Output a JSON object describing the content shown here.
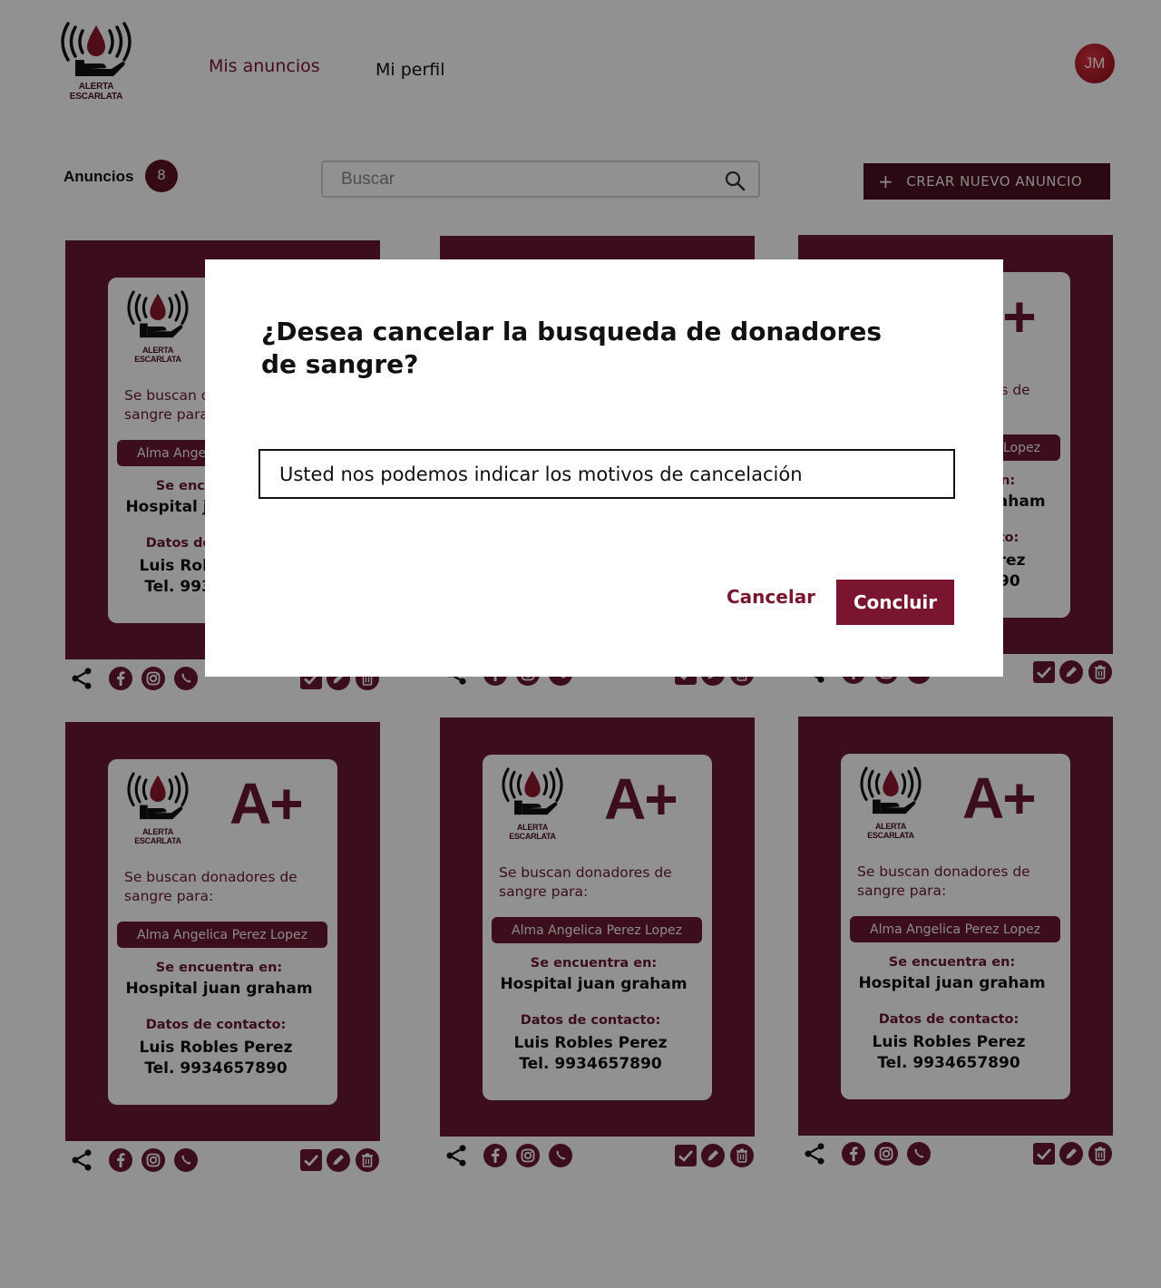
{
  "app": {
    "brand": "ALERTA ESCARLATA"
  },
  "nav": {
    "mis_anuncios": "Mis anuncios",
    "mi_perfil": "Mi perfil"
  },
  "user": {
    "initials": "JM"
  },
  "toolbar": {
    "count_label": "Anuncios",
    "count": "8",
    "search_placeholder": "Buscar",
    "create_label": "CREAR NUEVO ANUNCIO",
    "create_plus": "+"
  },
  "card": {
    "brand": "ALERTA ESCARLATA",
    "blood_type": "A+",
    "seeking": "Se buscan donadores de sangre para:",
    "patient": "Alma Angelica Perez Lopez",
    "location_label": "Se encuentra en:",
    "location": "Hospital juan graham",
    "contact_label": "Datos de contacto:",
    "contact_name": "Luis Robles Perez",
    "contact_phone": "Tel. 9934657890"
  },
  "modal": {
    "title": "¿Desea cancelar la busqueda de donadores de sangre?",
    "input_placeholder": "Usted nos podemos indicar los motivos de cancelación",
    "cancel_label": "Cancelar",
    "confirm_label": "Concluir"
  },
  "colors": {
    "brand_dark": "#4a1020",
    "card_bg": "#6a1730",
    "accent": "#7a1530",
    "overlay": "rgba(0,0,0,0.43)"
  },
  "icons": [
    "share-icon",
    "facebook-icon",
    "instagram-icon",
    "whatsapp-icon",
    "check-icon",
    "edit-icon",
    "trash-icon",
    "search-icon",
    "plus-icon"
  ]
}
